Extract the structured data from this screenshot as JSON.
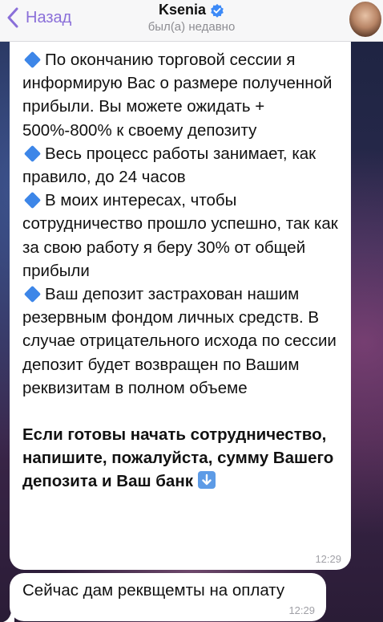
{
  "header": {
    "back_label": "Назад",
    "contact_name": "Ksenia",
    "status": "был(а) недавно"
  },
  "messages": [
    {
      "paragraphs": [
        "По окончанию торговой сессии я информирую Вас о размере полученной прибыли. Вы можете ожидать + 500%-800% к своему депозиту",
        "Весь процесс работы занимает, как правило, до 24 часов",
        "В моих интересах, чтобы сотрудничество прошло успешно, так как за свою работу я беру 30% от общей прибыли",
        "Ваш депозит застрахован нашим резервным фондом личных средств. В случае отрицательного исхода по сессии депозит будет возвращен по Вашим реквизитам в полном объеме"
      ],
      "bold_text": "Если готовы начать сотрудничество, напишите, пожалуйста, сумму Вашего депозита и Ваш банк",
      "time": "12:29"
    },
    {
      "text": "Сейчас дам реквщемты на оплату",
      "time": "12:29"
    }
  ],
  "colors": {
    "accent": "#8a6fd9",
    "verified": "#3d8af7",
    "diamond": "#3d86e8",
    "bubble": "#ffffff"
  },
  "icons": {
    "back": "chevron-left-icon",
    "verified": "verified-badge-icon",
    "bullet": "blue-diamond-icon",
    "arrow": "down-arrow-button-icon"
  }
}
